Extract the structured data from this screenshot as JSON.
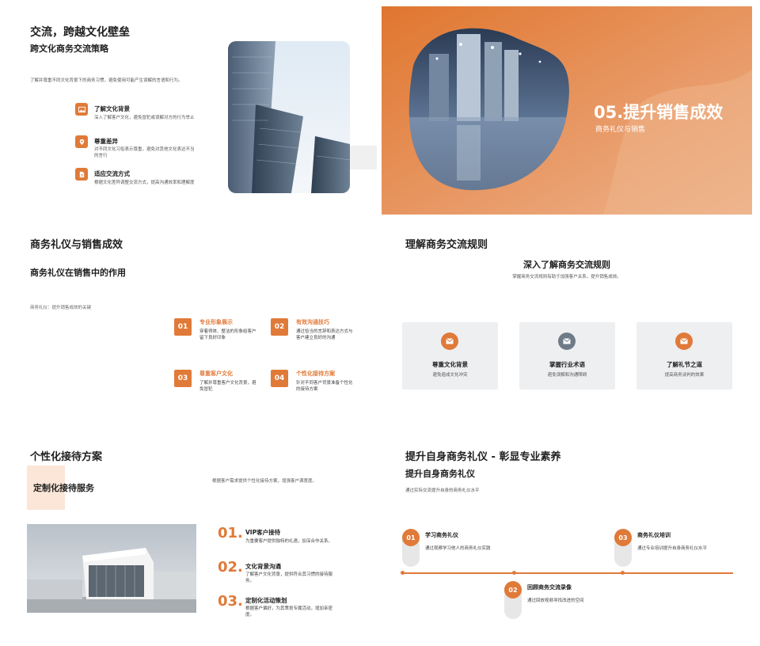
{
  "colors": {
    "accent": "#e07a39",
    "card_bg": "#eeeff1",
    "gray_icon": "#6f7a87"
  },
  "slide1": {
    "title": "交流，跨越文化壁垒",
    "subtitle": "跨文化商务交流策略",
    "intro": "了解并尊重不同文化背景下的商务习惯，避免使用可能产生误解的言语和行为。",
    "items": [
      {
        "icon": "image-icon",
        "title": "了解文化背景",
        "desc": "深入了解客户文化，避免冒犯或误解对方的行为举止"
      },
      {
        "icon": "location-pin-icon",
        "title": "尊重差异",
        "desc": "对不同文化习俗表示尊重，避免对其他文化表达不当的言行"
      },
      {
        "icon": "document-icon",
        "title": "适应交流方式",
        "desc": "根据文化差异调整交流方式，提高沟通效率和理解度"
      }
    ]
  },
  "slide2": {
    "title": "05.提升销售成效",
    "subtitle": "商务礼仪与销售"
  },
  "slide3": {
    "title": "商务礼仪与销售成效",
    "subtitle": "商务礼仪在销售中的作用",
    "caption": "商务礼仪：提升销售成效的关键",
    "items": [
      {
        "num": "01",
        "title": "专业形象展示",
        "desc": "穿着得体、整洁的形象给客户留下良好印象"
      },
      {
        "num": "02",
        "title": "有效沟通技巧",
        "desc": "通过恰当的言辞和表达方式与客户建立良好的沟通"
      },
      {
        "num": "03",
        "title": "尊重客户文化",
        "desc": "了解并尊重客户文化背景，避免冒犯"
      },
      {
        "num": "04",
        "title": "个性化接待方案",
        "desc": "针对不同客户背景准备个性化的接待方案"
      }
    ]
  },
  "slide4": {
    "title": "理解商务交流规则",
    "heading": "深入了解商务交流规则",
    "desc": "掌握商务交流规则有助于加强客户关系，提升销售成效。",
    "cards": [
      {
        "icon": "envelope-icon",
        "icon_color": "#e07a39",
        "title": "尊重文化背景",
        "desc": "避免造成文化冲突"
      },
      {
        "icon": "envelope-icon",
        "icon_color": "#6f7a87",
        "title": "掌握行业术语",
        "desc": "避免误解和沟通障碍"
      },
      {
        "icon": "envelope-icon",
        "icon_color": "#e07a39",
        "title": "了解礼节之道",
        "desc": "提高商务谈判的效果"
      }
    ]
  },
  "slide5": {
    "title": "个性化接待方案",
    "badge": "定制化接待服务",
    "desc": "根据客户需求提供个性化接待方案，增强客户满意度。",
    "items": [
      {
        "num": "01.",
        "title": "VIP客户接待",
        "desc": "为重要客户提供独特的礼遇，加深合作关系。"
      },
      {
        "num": "02.",
        "title": "文化背景沟通",
        "desc": "了解客户文化背景，提供符合其习惯的接待服务。"
      },
      {
        "num": "03.",
        "title": "定制化活动策划",
        "desc": "根据客户偏好，为其策划专属活动，增加亲密度。"
      }
    ]
  },
  "slide6": {
    "title": "提升自身商务礼仪 - 彰显专业素养",
    "subtitle": "提升自身商务礼仪",
    "desc": "通过实际交流提升自身的商务礼仪水平",
    "steps": [
      {
        "num": "01",
        "title": "学习商务礼仪",
        "desc": "通过观察学习他人的商务礼仪实践"
      },
      {
        "num": "02",
        "title": "回顾商务交流录像",
        "desc": "通过回放视频寻找改进的空间"
      },
      {
        "num": "03",
        "title": "商务礼仪培训",
        "desc": "通过专业培训提升自身商务礼仪水平"
      }
    ]
  }
}
